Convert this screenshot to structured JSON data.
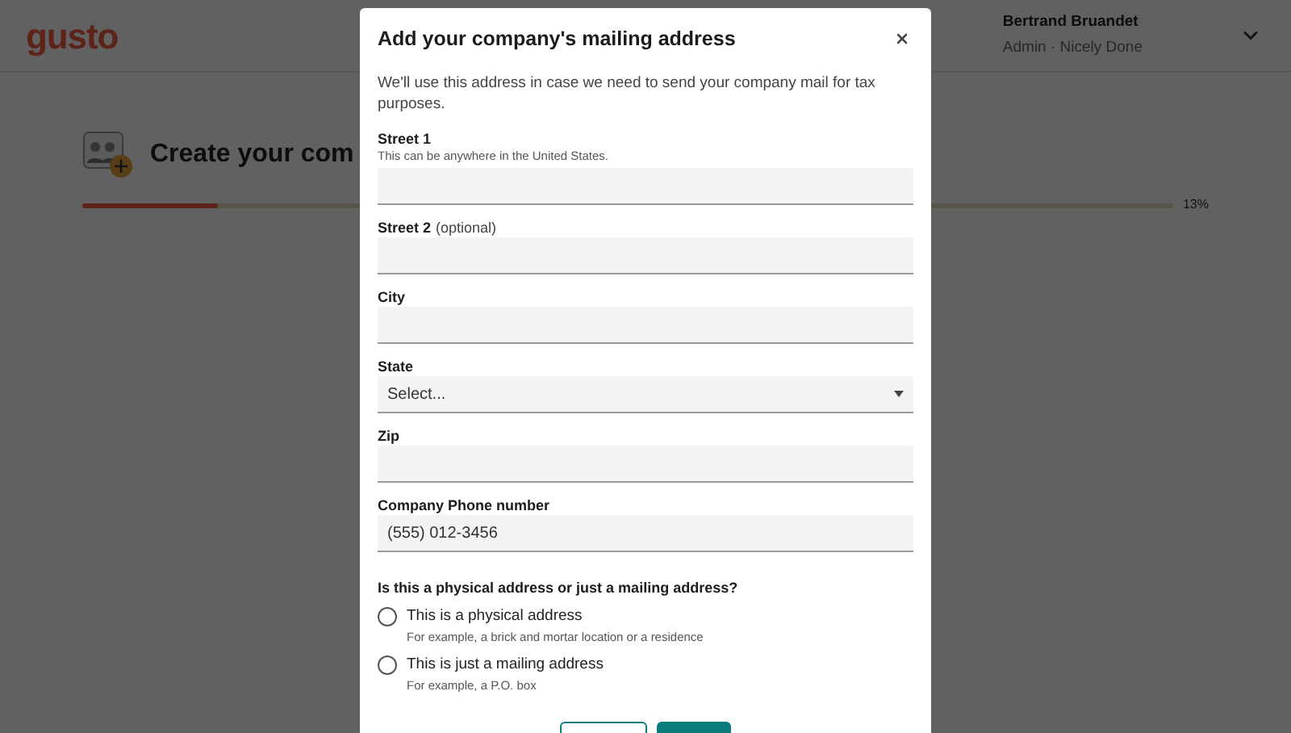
{
  "header": {
    "logo": "gusto",
    "user_name": "Bertrand Bruandet",
    "user_role": "Admin · Nicely Done"
  },
  "page": {
    "title": "Create your com",
    "progress": {
      "level": 0.124,
      "reading": "13%"
    }
  },
  "dialog": {
    "title": "Add your company's mailing address",
    "description": "We'll use this address in case we need to send your company mail for tax purposes.",
    "fields": [
      {
        "kind": "text",
        "label": "Street 1",
        "hint": "This can be anywhere in the United States."
      },
      {
        "kind": "text",
        "label": "Street 2",
        "label_note": "(optional)"
      },
      {
        "kind": "text",
        "label": "City"
      },
      {
        "kind": "select",
        "label": "State",
        "placeholder": "Select..."
      },
      {
        "kind": "text",
        "label": "Zip"
      },
      {
        "kind": "text",
        "label": "Company Phone number",
        "value": "(555) 012-3456"
      }
    ],
    "question": "Is this a physical address or just a mailing address?",
    "options": [
      {
        "label": "This is a physical address",
        "description": "For example, a brick and mortar location or a residence",
        "selected": false
      },
      {
        "label": "This is just a mailing address",
        "description": "For example, a P.O. box",
        "selected": false
      }
    ],
    "buttons": [
      {
        "kind": "secondary"
      },
      {
        "kind": "primary"
      }
    ]
  }
}
